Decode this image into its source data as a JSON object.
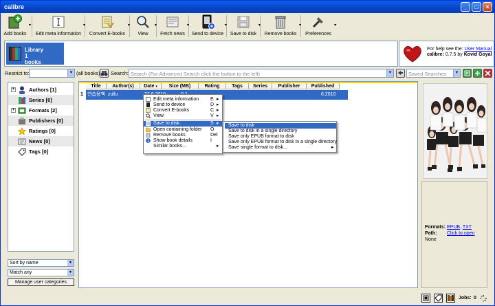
{
  "window": {
    "title": "calibre"
  },
  "toolbar": {
    "items": [
      {
        "label": "Add books",
        "icon": "add-books-icon",
        "has_menu": true
      },
      {
        "label": "Edit meta information",
        "icon": "edit-metadata-icon",
        "has_menu": true
      },
      {
        "label": "Convert E-books",
        "icon": "convert-ebooks-icon",
        "has_menu": true
      },
      {
        "label": "View",
        "icon": "view-icon",
        "has_menu": true
      },
      {
        "label": "Fetch news",
        "icon": "fetch-news-icon",
        "has_menu": true
      },
      {
        "label": "Send to device",
        "icon": "send-to-device-icon",
        "has_menu": true
      },
      {
        "label": "Save to disk",
        "icon": "save-to-disk-icon",
        "has_menu": true
      },
      {
        "label": "Remove books",
        "icon": "remove-books-icon",
        "has_menu": true
      },
      {
        "label": "Preferences",
        "icon": "preferences-icon",
        "has_menu": true
      }
    ]
  },
  "library": {
    "title": "Library",
    "count": "1",
    "unit": "books"
  },
  "help": {
    "prefix": "For help see the:",
    "link": "User Manual",
    "version_label": "calibre:",
    "version": "0.7.5 by",
    "author": "Kovid Goyal"
  },
  "search": {
    "restrict_label": "Restrict to:",
    "restrict_value": "",
    "all_books": "(all books)",
    "search_label": "Search:",
    "placeholder": "Search (For Advanced Search click the button to the left)",
    "saved_searches_placeholder": "Saved Searches"
  },
  "tag_browser": {
    "items": [
      {
        "label": "Authors",
        "count": "[1]",
        "expandable": true,
        "icon": "authors-icon"
      },
      {
        "label": "Series",
        "count": "[0]",
        "expandable": false,
        "icon": "series-icon"
      },
      {
        "label": "Formats",
        "count": "[2]",
        "expandable": true,
        "icon": "formats-icon"
      },
      {
        "label": "Publishers",
        "count": "[0]",
        "expandable": false,
        "icon": "publishers-icon"
      },
      {
        "label": "Ratings",
        "count": "[0]",
        "expandable": false,
        "icon": "ratings-icon"
      },
      {
        "label": "News",
        "count": "[0]",
        "expandable": false,
        "icon": "news-icon"
      },
      {
        "label": "Tags",
        "count": "[0]",
        "expandable": false,
        "icon": "tags-icon"
      }
    ],
    "sort_by": "Sort by name",
    "match": "Match any",
    "manage_button": "Manage user categories"
  },
  "book_list": {
    "columns": [
      "Title",
      "Author(s)",
      "Date",
      "Size (MB)",
      "Rating",
      "Tags",
      "Series",
      "Publisher",
      "Published"
    ],
    "rows": [
      {
        "num": "1",
        "title": "연습용책",
        "author": "zullu",
        "date": "27.6.2010",
        "size": "0.1",
        "published": "6.2010"
      }
    ]
  },
  "context_menu": {
    "items": [
      {
        "label": "Edit meta information",
        "shortcut": "E",
        "submenu": true,
        "icon": "edit-metadata-icon"
      },
      {
        "label": "Send to device",
        "shortcut": "D",
        "submenu": true,
        "icon": "send-to-device-icon"
      },
      {
        "label": "Convert E-books",
        "shortcut": "C",
        "submenu": true,
        "icon": "convert-ebooks-icon"
      },
      {
        "label": "View",
        "shortcut": "V",
        "submenu": true,
        "icon": "view-icon"
      },
      {
        "label": "Save to disk",
        "shortcut": "S",
        "submenu": true,
        "icon": "save-to-disk-icon",
        "highlighted": true
      },
      {
        "label": "Open containing folder",
        "shortcut": "O",
        "submenu": false,
        "icon": "folder-icon"
      },
      {
        "label": "Remove books",
        "shortcut": "Del",
        "submenu": false,
        "icon": "remove-books-icon"
      },
      {
        "label": "Show book details",
        "shortcut": "I",
        "submenu": false,
        "icon": "info-icon"
      },
      {
        "label": "Similar books...",
        "shortcut": "",
        "submenu": true,
        "icon": ""
      }
    ]
  },
  "save_submenu": {
    "items": [
      {
        "label": "Save to disk",
        "highlighted": true,
        "submenu": false
      },
      {
        "label": "Save to disk in a single directory",
        "submenu": false
      },
      {
        "label": "Save only EPUB format to disk",
        "submenu": false
      },
      {
        "label": "Save only EPUB format to disk in a single directory",
        "submenu": false
      },
      {
        "label": "Save single format to disk...",
        "submenu": true
      }
    ]
  },
  "details": {
    "formats_label": "Formats:",
    "formats": [
      "EPUB",
      "TXT"
    ],
    "path_label": "Path:",
    "path_link": "Click to open",
    "extra": "None"
  },
  "status": {
    "jobs_label": "Jobs:",
    "jobs": "0"
  },
  "colors": {
    "selection": "#316ac5",
    "titlebar": "#0843c6",
    "accent_yellow": "#ffd800"
  }
}
